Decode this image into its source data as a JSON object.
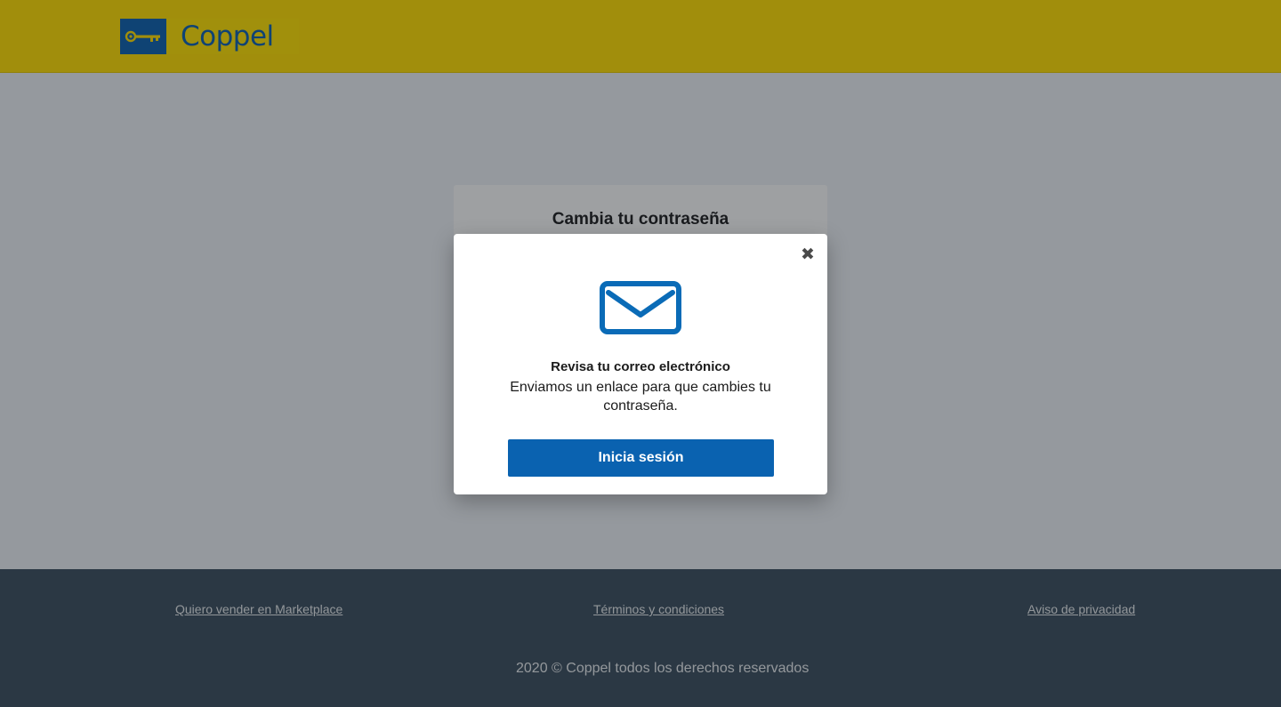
{
  "header": {
    "logo_text": "Coppel",
    "brand_color": "#ffdd00",
    "logo_color": "#0c5fad",
    "logo_icon": "key-icon"
  },
  "card": {
    "title": "Cambia tu contraseña"
  },
  "modal": {
    "close_icon": "close-icon",
    "close_glyph": "✖",
    "mail_icon": "envelope-icon",
    "heading": "Revisa tu correo electrónico",
    "body": "Enviamos un enlace para que cambies tu contraseña.",
    "button_label": "Inicia sesión",
    "button_color": "#0a62b0"
  },
  "footer": {
    "links": [
      "Quiero vender en Marketplace",
      "Términos y condiciones",
      " Aviso de privacidad"
    ],
    "copyright": "2020 © Coppel todos los derechos reservados",
    "background": "#3b4e5e"
  }
}
